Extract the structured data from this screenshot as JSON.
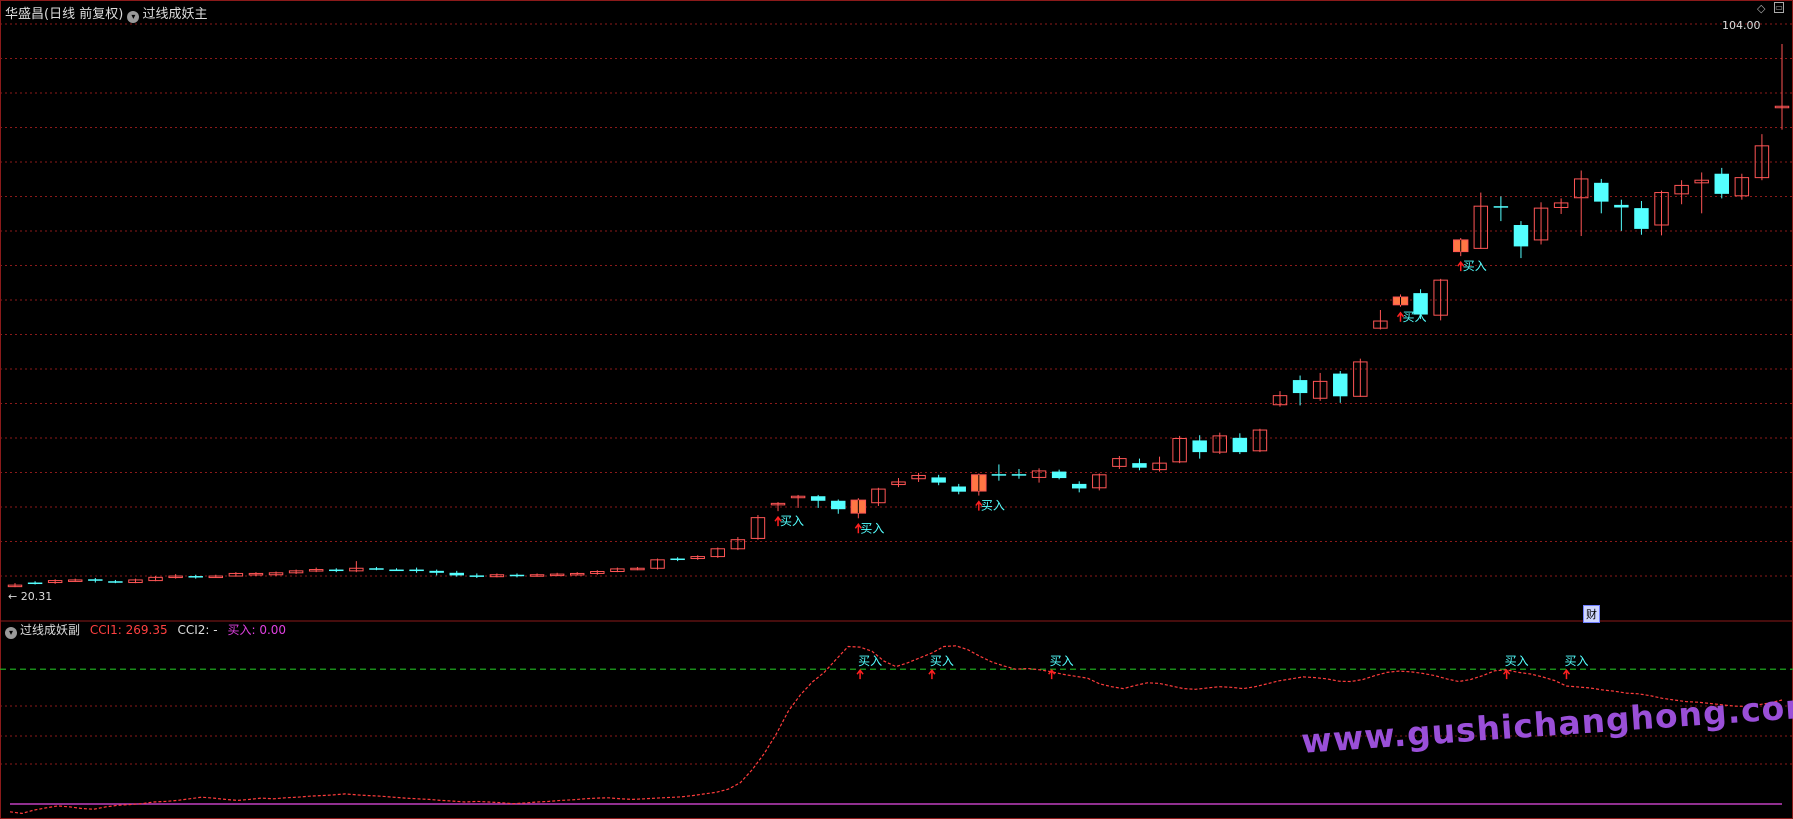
{
  "header": {
    "stock_name": "华盛昌",
    "period": "(日线 前复权)",
    "indicator_main": "过线成妖主",
    "indicator_sub": "过线成妖副",
    "cci1_label": "CCI1:",
    "cci1_value": "269.35",
    "cci2_label": "CCI2: -",
    "buy_label": "买入:",
    "buy_value": "0.00",
    "fin_badge": "财"
  },
  "colors": {
    "up": "#ff5555",
    "down": "#54ffff",
    "grid": "#8b1a1a",
    "cci_line": "#ff3c3c",
    "threshold": "#22bb22",
    "baseline": "#c040c0",
    "buy_text": "#54ffff",
    "signal_fill": "#ff7744"
  },
  "chart_data": [
    {
      "type": "candlestick",
      "title": "华盛昌 (日线 前复权)",
      "ylim": [
        18,
        108
      ],
      "price_labels": {
        "max": "104.00",
        "min": "20.31"
      },
      "signal_label": "买入",
      "candles": [
        [
          20.6,
          20.5,
          20.9,
          20.3,
          "up",
          ""
        ],
        [
          20.9,
          21.0,
          21.2,
          20.7,
          "down",
          ""
        ],
        [
          21.0,
          21.3,
          21.5,
          20.8,
          "up",
          ""
        ],
        [
          21.3,
          21.4,
          21.6,
          21.1,
          "up",
          ""
        ],
        [
          21.5,
          21.3,
          21.7,
          21.0,
          "down",
          ""
        ],
        [
          21.2,
          21.0,
          21.4,
          20.9,
          "down",
          ""
        ],
        [
          21.0,
          21.4,
          21.6,
          20.9,
          "up",
          ""
        ],
        [
          21.3,
          21.8,
          22.0,
          21.2,
          "up",
          ""
        ],
        [
          21.8,
          22.0,
          22.3,
          21.6,
          "up",
          ""
        ],
        [
          22.0,
          21.8,
          22.2,
          21.6,
          "down",
          ""
        ],
        [
          21.8,
          22.0,
          22.2,
          21.7,
          "up",
          ""
        ],
        [
          22.0,
          22.4,
          22.6,
          21.9,
          "up",
          ""
        ],
        [
          22.4,
          22.2,
          22.6,
          22.0,
          "up",
          ""
        ],
        [
          22.2,
          22.5,
          22.7,
          22.0,
          "up",
          ""
        ],
        [
          22.5,
          22.8,
          23.0,
          22.3,
          "up",
          ""
        ],
        [
          22.8,
          23.0,
          23.3,
          22.6,
          "up",
          ""
        ],
        [
          23.0,
          22.8,
          23.2,
          22.6,
          "down",
          ""
        ],
        [
          22.8,
          23.2,
          24.3,
          22.6,
          "up",
          ""
        ],
        [
          23.2,
          23.0,
          23.4,
          22.9,
          "down",
          ""
        ],
        [
          23.0,
          23.0,
          23.2,
          22.8,
          "down",
          ""
        ],
        [
          23.0,
          22.8,
          23.3,
          22.5,
          "down",
          ""
        ],
        [
          22.8,
          22.5,
          23.0,
          22.1,
          "down",
          ""
        ],
        [
          22.5,
          22.1,
          22.8,
          21.9,
          "down",
          ""
        ],
        [
          22.1,
          21.9,
          22.4,
          21.7,
          "down",
          ""
        ],
        [
          21.9,
          22.2,
          22.4,
          21.8,
          "up",
          ""
        ],
        [
          22.2,
          22.0,
          22.4,
          21.8,
          "down",
          ""
        ],
        [
          22.0,
          22.2,
          22.4,
          21.9,
          "up",
          ""
        ],
        [
          22.2,
          22.3,
          22.5,
          22.0,
          "up",
          ""
        ],
        [
          22.3,
          22.4,
          22.6,
          22.1,
          "up",
          ""
        ],
        [
          22.4,
          22.7,
          22.9,
          22.2,
          "up",
          ""
        ],
        [
          22.7,
          23.1,
          23.3,
          22.6,
          "up",
          ""
        ],
        [
          23.1,
          23.2,
          23.4,
          22.9,
          "up",
          ""
        ],
        [
          23.2,
          24.5,
          24.7,
          23.0,
          "up",
          ""
        ],
        [
          24.5,
          24.7,
          24.9,
          24.3,
          "down",
          ""
        ],
        [
          24.7,
          25.0,
          25.2,
          24.5,
          "up",
          ""
        ],
        [
          25.0,
          26.2,
          26.4,
          24.8,
          "up",
          ""
        ],
        [
          26.2,
          27.6,
          28.0,
          26.0,
          "up",
          ""
        ],
        [
          27.8,
          31.0,
          31.4,
          27.6,
          "up",
          ""
        ],
        [
          33.1,
          33.2,
          33.4,
          32.0,
          "up",
          "买入"
        ],
        [
          34.3,
          34.3,
          34.5,
          32.5,
          "up",
          ""
        ],
        [
          34.3,
          33.6,
          34.5,
          32.5,
          "down",
          ""
        ],
        [
          33.6,
          32.3,
          33.8,
          31.6,
          "down",
          ""
        ],
        [
          31.7,
          33.7,
          34.0,
          30.9,
          "signal",
          "买入"
        ],
        [
          33.3,
          35.4,
          35.6,
          32.8,
          "up",
          ""
        ],
        [
          36.1,
          36.5,
          37.1,
          35.7,
          "up",
          ""
        ],
        [
          37.0,
          37.5,
          37.9,
          36.5,
          "up",
          ""
        ],
        [
          37.2,
          36.4,
          37.6,
          36.0,
          "down",
          ""
        ],
        [
          35.8,
          35.0,
          36.2,
          34.6,
          "down",
          ""
        ],
        [
          35.1,
          37.6,
          37.8,
          34.4,
          "signal",
          "买入"
        ],
        [
          37.7,
          37.7,
          39.2,
          36.7,
          "down",
          ""
        ],
        [
          37.7,
          37.7,
          38.5,
          37.0,
          "down",
          ""
        ],
        [
          37.2,
          38.2,
          38.6,
          36.4,
          "up",
          ""
        ],
        [
          38.1,
          37.1,
          38.4,
          36.9,
          "down",
          ""
        ],
        [
          36.2,
          35.5,
          36.6,
          34.9,
          "down",
          ""
        ],
        [
          35.6,
          37.6,
          37.8,
          35.2,
          "up",
          ""
        ],
        [
          38.9,
          40.1,
          40.5,
          38.5,
          "up",
          ""
        ],
        [
          39.4,
          38.7,
          40.1,
          38.3,
          "down",
          ""
        ],
        [
          38.4,
          39.4,
          40.4,
          38.1,
          "up",
          ""
        ],
        [
          39.6,
          43.2,
          43.6,
          39.4,
          "up",
          ""
        ],
        [
          42.9,
          41.1,
          43.7,
          40.1,
          "down",
          ""
        ],
        [
          41.1,
          43.6,
          44.1,
          40.8,
          "up",
          ""
        ],
        [
          43.3,
          41.1,
          44.0,
          40.8,
          "down",
          ""
        ],
        [
          41.3,
          44.5,
          44.7,
          41.1,
          "up",
          ""
        ],
        [
          48.4,
          49.8,
          50.5,
          48.1,
          "up",
          ""
        ],
        [
          52.2,
          50.2,
          52.9,
          48.3,
          "down",
          ""
        ],
        [
          49.4,
          52.0,
          53.3,
          49.0,
          "up",
          ""
        ],
        [
          53.2,
          49.7,
          53.6,
          48.7,
          "down",
          ""
        ],
        [
          49.7,
          55.0,
          55.5,
          49.6,
          "up",
          ""
        ],
        [
          60.2,
          61.3,
          63.0,
          60.0,
          "up",
          ""
        ],
        [
          63.8,
          65.0,
          65.4,
          63.5,
          "signal",
          "买入"
        ],
        [
          65.6,
          62.3,
          66.2,
          61.6,
          "down",
          ""
        ],
        [
          62.2,
          67.6,
          67.8,
          61.4,
          "up",
          ""
        ],
        [
          73.8,
          72.0,
          74.1,
          71.3,
          "signal",
          "买入"
        ],
        [
          72.5,
          79.0,
          81.1,
          72.4,
          "up",
          ""
        ],
        [
          79.0,
          79.0,
          80.5,
          76.7,
          "down",
          ""
        ],
        [
          76.1,
          72.8,
          76.7,
          71.0,
          "down",
          ""
        ],
        [
          73.8,
          78.7,
          79.6,
          73.1,
          "up",
          ""
        ],
        [
          78.8,
          79.5,
          80.2,
          77.8,
          "up",
          ""
        ],
        [
          80.3,
          83.2,
          84.5,
          74.4,
          "up",
          ""
        ],
        [
          82.6,
          79.7,
          83.2,
          77.9,
          "down",
          ""
        ],
        [
          79.2,
          78.8,
          80.0,
          75.2,
          "down",
          ""
        ],
        [
          78.7,
          75.5,
          79.8,
          74.6,
          "down",
          ""
        ],
        [
          76.1,
          81.1,
          81.4,
          74.5,
          "up",
          ""
        ],
        [
          80.9,
          82.2,
          83.0,
          79.3,
          "up",
          ""
        ],
        [
          82.6,
          83.0,
          84.2,
          77.9,
          "up",
          ""
        ],
        [
          84.0,
          80.9,
          84.9,
          80.2,
          "down",
          ""
        ],
        [
          80.6,
          83.4,
          84.0,
          80.0,
          "up",
          ""
        ],
        [
          83.4,
          88.3,
          90.1,
          83.0,
          "up",
          ""
        ],
        [
          94.3,
          94.4,
          104.0,
          90.8,
          "up",
          ""
        ]
      ]
    },
    {
      "type": "line",
      "title": "过线成妖副",
      "series": [
        {
          "name": "CCI1",
          "values": [
            -190,
            -195,
            -185,
            -178,
            -172,
            -175,
            -180,
            -182,
            -175,
            -170,
            -168,
            -165,
            -160,
            -158,
            -155,
            -150,
            -145,
            -148,
            -152,
            -155,
            -152,
            -148,
            -150,
            -147,
            -145,
            -142,
            -140,
            -138,
            -135,
            -138,
            -140,
            -142,
            -145,
            -148,
            -150,
            -152,
            -155,
            -157,
            -160,
            -158,
            -160,
            -162,
            -165,
            -163,
            -160,
            -158,
            -155,
            -153,
            -150,
            -148,
            -147,
            -150,
            -152,
            -150,
            -148,
            -146,
            -144,
            -140,
            -135,
            -130,
            -120,
            -100,
            -60,
            -10,
            50,
            120,
            170,
            210,
            240,
            280,
            320,
            318,
            305,
            275,
            258,
            270,
            285,
            300,
            320,
            322,
            310,
            290,
            272,
            260,
            250,
            252,
            248,
            242,
            234,
            228,
            222,
            205,
            196,
            190,
            200,
            208,
            206,
            198,
            190,
            188,
            192,
            196,
            194,
            190,
            196,
            205,
            214,
            220,
            226,
            224,
            220,
            213,
            212,
            218,
            230,
            240,
            244,
            242,
            237,
            230,
            220,
            212,
            218,
            230,
            245,
            248,
            240,
            235,
            226,
            215,
            198,
            195,
            192,
            186,
            182,
            176,
            174,
            168,
            160,
            155,
            150,
            148,
            144,
            140,
            136,
            135,
            140,
            146,
            155
          ]
        }
      ],
      "levels": {
        "threshold": 250,
        "baseline": -166
      },
      "ylim": [
        -200,
        340
      ],
      "signal_indices": [
        71,
        77,
        87,
        125,
        130
      ],
      "signal_label": "买入"
    }
  ]
}
